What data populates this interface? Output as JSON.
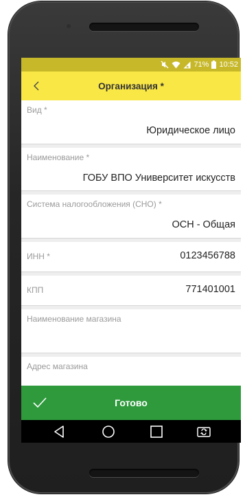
{
  "statusbar": {
    "battery": "71%",
    "time": "10:52",
    "icons": [
      "mute-icon",
      "wifi-icon",
      "signal-icon",
      "battery-icon"
    ]
  },
  "appbar": {
    "back_icon": "chevron-left-icon",
    "title": "Организация *"
  },
  "fields": [
    {
      "label": "Вид *",
      "value": "Юридическое лицо"
    },
    {
      "label": "Наименование *",
      "value": "ГОБУ ВПО Университет искусств"
    },
    {
      "label": "Система налогообложения (СНО) *",
      "value": "ОСН - Общая"
    },
    {
      "label": "ИНН *",
      "value": "0123456788"
    },
    {
      "label": "КПП",
      "value": "771401001"
    },
    {
      "label": "Наименование магазина",
      "value": ""
    },
    {
      "label": "Адрес магазина",
      "value": ""
    }
  ],
  "bottom_bar": {
    "icon": "check-icon",
    "label": "Готово"
  },
  "navbar": {
    "icons": [
      "back-triangle-icon",
      "home-circle-icon",
      "recents-square-icon",
      "screen-rotate-icon"
    ]
  },
  "colors": {
    "statusbar": "#c7b82a",
    "appbar": "#f9e746",
    "done_bar": "#2e9a3c",
    "label": "#9a9a9a",
    "value": "#222222"
  }
}
